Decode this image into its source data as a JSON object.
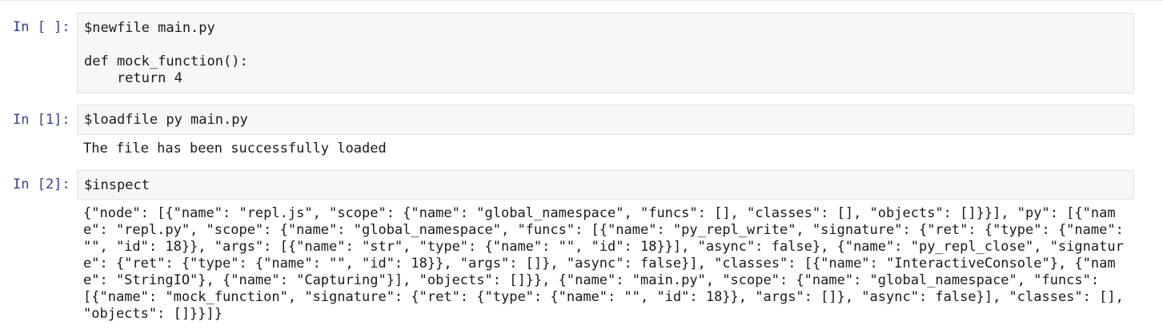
{
  "cells": [
    {
      "prompt": "In [ ]:",
      "code_lines": [
        "$newfile main.py",
        "",
        "def mock_function():",
        "    return 4"
      ],
      "output": ""
    },
    {
      "prompt": "In [1]:",
      "code_lines": [
        "$loadfile py main.py"
      ],
      "output": "The file has been successfully loaded"
    },
    {
      "prompt": "In [2]:",
      "code_lines": [
        "$inspect"
      ],
      "output": "{\"node\": [{\"name\": \"repl.js\", \"scope\": {\"name\": \"global_namespace\", \"funcs\": [], \"classes\": [], \"objects\": []}}], \"py\": [{\"name\": \"repl.py\", \"scope\": {\"name\": \"global_namespace\", \"funcs\": [{\"name\": \"py_repl_write\", \"signature\": {\"ret\": {\"type\": {\"name\": \"\", \"id\": 18}}, \"args\": [{\"name\": \"str\", \"type\": {\"name\": \"\", \"id\": 18}}], \"async\": false}, {\"name\": \"py_repl_close\", \"signature\": {\"ret\": {\"type\": {\"name\": \"\", \"id\": 18}}, \"args\": []}, \"async\": false}], \"classes\": [{\"name\": \"InteractiveConsole\"}, {\"name\": \"StringIO\"}, {\"name\": \"Capturing\"}], \"objects\": []}}, {\"name\": \"main.py\", \"scope\": {\"name\": \"global_namespace\", \"funcs\": [{\"name\": \"mock_function\", \"signature\": {\"ret\": {\"type\": {\"name\": \"\", \"id\": 18}}, \"args\": []}, \"async\": false}], \"classes\": [], \"objects\": []}}]}"
    }
  ]
}
